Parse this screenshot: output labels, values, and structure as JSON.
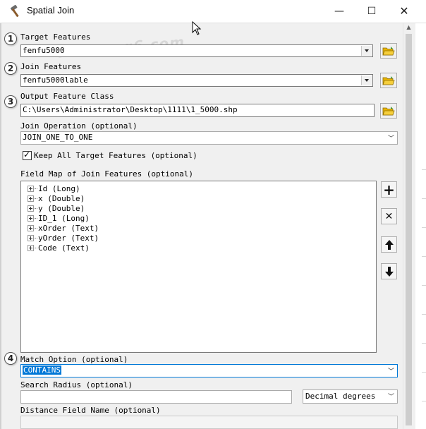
{
  "window": {
    "title": "Spatial Join",
    "minimize_glyph": "—",
    "maximize_glyph": "☐",
    "close_glyph": "✕"
  },
  "watermark": "www.cgg6.com",
  "badges": [
    "1",
    "2",
    "3",
    "4"
  ],
  "target_features": {
    "label": "Target Features",
    "value": "fenfu5000"
  },
  "join_features": {
    "label": "Join Features",
    "value": "fenfu5000lable"
  },
  "output_feature_class": {
    "label": "Output Feature Class",
    "value": "C:\\Users\\Administrator\\Desktop\\1111\\1_5000.shp"
  },
  "join_operation": {
    "label": "Join Operation (optional)",
    "value": "JOIN_ONE_TO_ONE"
  },
  "keep_all": {
    "label": "Keep All Target Features (optional)",
    "checked": true,
    "check_glyph": "✓"
  },
  "field_map": {
    "label": "Field Map of Join Features (optional)",
    "items": [
      "Id (Long)",
      "x (Double)",
      "y (Double)",
      "ID_1 (Long)",
      "xOrder (Text)",
      "yOrder (Text)",
      "Code (Text)"
    ],
    "buttons": {
      "add": "+",
      "remove": "✕",
      "up": "🡅",
      "down": "🡇"
    }
  },
  "match_option": {
    "label": "Match Option (optional)",
    "value": "CONTAINS"
  },
  "search_radius": {
    "label": "Search Radius (optional)",
    "value": "",
    "units": "Decimal degrees"
  },
  "distance_field": {
    "label": "Distance Field Name (optional)",
    "value": ""
  },
  "colors": {
    "selection": "#0078d7",
    "panel": "#f0f0f0",
    "folder_yellow": "#e8b400",
    "folder_green": "#3a9d3a"
  },
  "icons": {
    "app": "hammer-icon",
    "folder": "open-folder-icon",
    "cursor": "mouse-pointer-icon"
  }
}
